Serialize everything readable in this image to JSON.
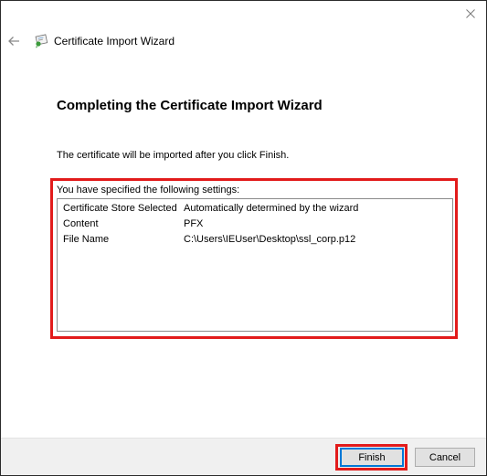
{
  "window": {
    "title": "Certificate Import Wizard"
  },
  "page": {
    "heading": "Completing the Certificate Import Wizard",
    "intro": "The certificate will be imported after you click Finish.",
    "settings_caption": "You have specified the following settings:",
    "settings": [
      {
        "key": "Certificate Store Selected",
        "value": "Automatically determined by the wizard"
      },
      {
        "key": "Content",
        "value": "PFX"
      },
      {
        "key": "File Name",
        "value": "C:\\Users\\IEUser\\Desktop\\ssl_corp.p12"
      }
    ]
  },
  "footer": {
    "finish_label": "Finish",
    "cancel_label": "Cancel"
  },
  "colors": {
    "highlight": "#e21b1b",
    "focus_border": "#0078d7"
  }
}
